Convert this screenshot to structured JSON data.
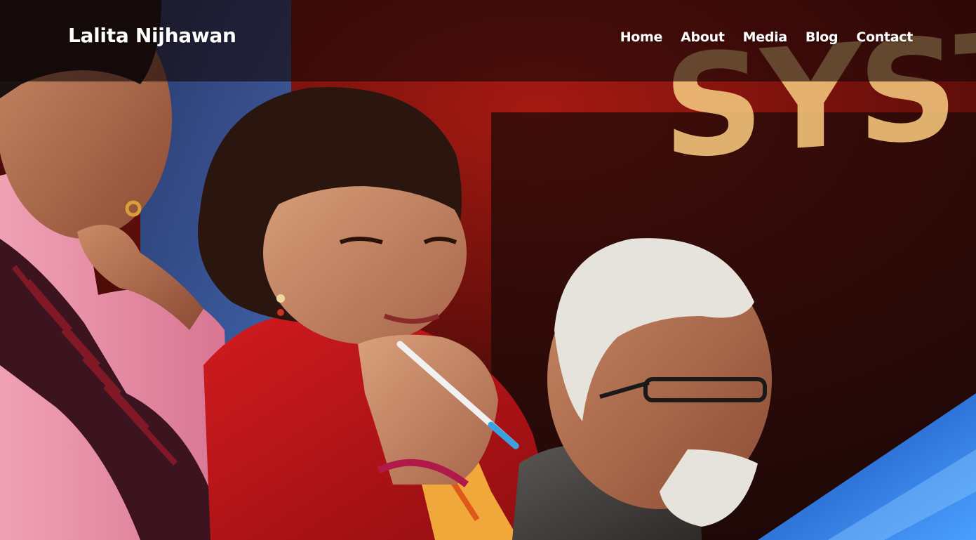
{
  "site": {
    "brand": "Lalita Nijhawan"
  },
  "nav": {
    "items": [
      {
        "label": "Home"
      },
      {
        "label": "About"
      },
      {
        "label": "Media"
      },
      {
        "label": "Blog"
      },
      {
        "label": "Contact"
      }
    ]
  },
  "hero": {
    "backdrop_text": "SYST",
    "colors": {
      "backdrop_red": "#8e1410",
      "backdrop_dark": "#1d0a08",
      "stage_blue": "#2f5aa8",
      "backdrop_lettering": "#f2c27a",
      "red_jacket": "#c4161c",
      "pink_shirt": "#e98aa0"
    }
  }
}
